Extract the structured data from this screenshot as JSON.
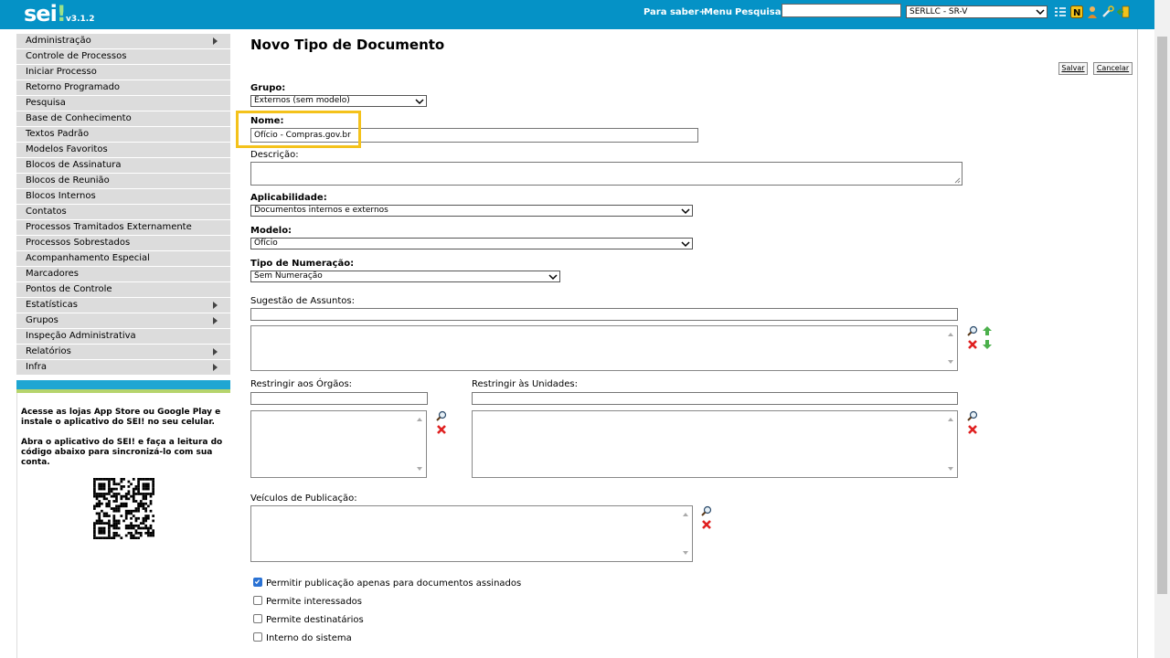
{
  "header": {
    "logo_text": "sei",
    "logo_excl": "!",
    "version": "v3.1.2",
    "nav": [
      "Para saber+",
      "Menu",
      "Pesquisa"
    ],
    "search_value": "",
    "unit_select": "SERLLC - SR-V",
    "icons": [
      "list-icon",
      "notes-icon",
      "user-icon",
      "tools-icon",
      "exit-icon"
    ],
    "colors": {
      "bar": "#0592c6",
      "logo_accent": "#9ce38a"
    }
  },
  "sidebar": {
    "items": [
      {
        "label": "Administração",
        "submenu": true
      },
      {
        "label": "Controle de Processos",
        "submenu": false
      },
      {
        "label": "Iniciar Processo",
        "submenu": false
      },
      {
        "label": "Retorno Programado",
        "submenu": false
      },
      {
        "label": "Pesquisa",
        "submenu": false
      },
      {
        "label": "Base de Conhecimento",
        "submenu": false
      },
      {
        "label": "Textos Padrão",
        "submenu": false
      },
      {
        "label": "Modelos Favoritos",
        "submenu": false
      },
      {
        "label": "Blocos de Assinatura",
        "submenu": false
      },
      {
        "label": "Blocos de Reunião",
        "submenu": false
      },
      {
        "label": "Blocos Internos",
        "submenu": false
      },
      {
        "label": "Contatos",
        "submenu": false
      },
      {
        "label": "Processos Tramitados Externamente",
        "submenu": false
      },
      {
        "label": "Processos Sobrestados",
        "submenu": false
      },
      {
        "label": "Acompanhamento Especial",
        "submenu": false
      },
      {
        "label": "Marcadores",
        "submenu": false
      },
      {
        "label": "Pontos de Controle",
        "submenu": false
      },
      {
        "label": "Estatísticas",
        "submenu": true
      },
      {
        "label": "Grupos",
        "submenu": true
      },
      {
        "label": "Inspeção Administrativa",
        "submenu": false
      },
      {
        "label": "Relatórios",
        "submenu": true
      },
      {
        "label": "Infra",
        "submenu": true
      }
    ],
    "app_text_1": "Acesse as lojas App Store ou Google Play e instale o aplicativo do SEI! no seu celular.",
    "app_text_2": "Abra o aplicativo do SEI! e faça a leitura do código abaixo para sincronizá-lo com sua conta."
  },
  "form": {
    "title": "Novo Tipo de Documento",
    "save_label": "Salvar",
    "cancel_label": "Cancelar",
    "grupo_label": "Grupo:",
    "grupo_value": "Externos (sem modelo)",
    "nome_label": "Nome:",
    "nome_value": "Ofício - Compras.gov.br",
    "descricao_label": "Descrição:",
    "aplicabilidade_label": "Aplicabilidade:",
    "aplicabilidade_value": "Documentos internos e externos",
    "modelo_label": "Modelo:",
    "modelo_value": "Ofício",
    "numeracao_label": "Tipo de Numeração:",
    "numeracao_value": "Sem Numeração",
    "assuntos_label": "Sugestão de Assuntos:",
    "orgaos_label": "Restringir aos Órgãos:",
    "unidades_label": "Restringir às Unidades:",
    "veiculos_label": "Veículos de Publicação:",
    "checkboxes": [
      {
        "label": "Permitir publicação apenas para documentos assinados",
        "checked": true
      },
      {
        "label": "Permite interessados",
        "checked": false
      },
      {
        "label": "Permite destinatários",
        "checked": false
      },
      {
        "label": "Interno do sistema",
        "checked": false
      }
    ]
  }
}
